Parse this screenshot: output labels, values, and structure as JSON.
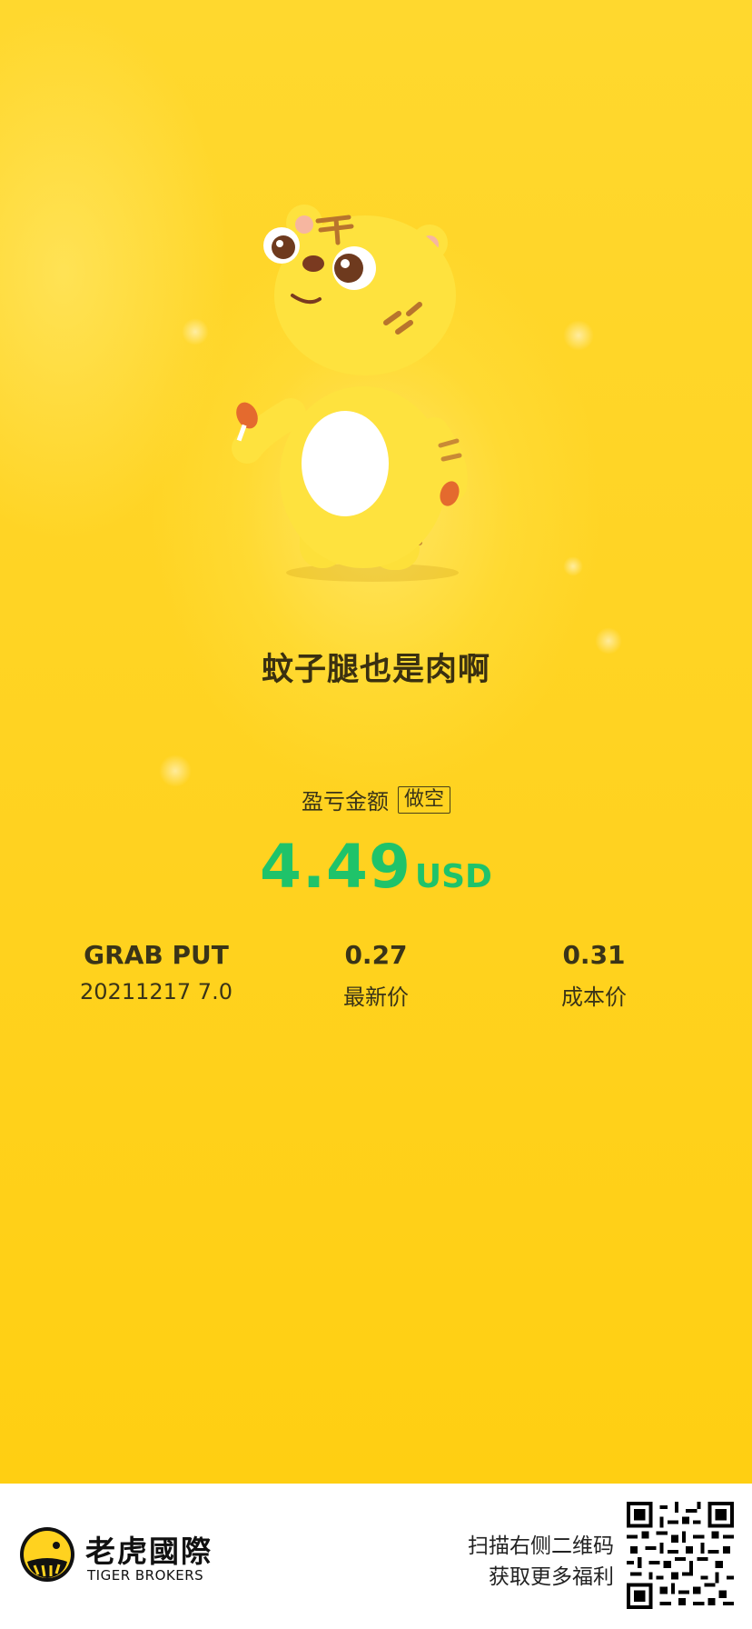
{
  "slogan": "蚊子腿也是肉啊",
  "pnl": {
    "label": "盈亏金额",
    "direction": "做空",
    "amount": "4.49",
    "currency": "USD",
    "amount_color": "#1fc36a"
  },
  "instrument": {
    "name": "GRAB PUT",
    "detail": "20211217  7.0"
  },
  "latest_price": {
    "value": "0.27",
    "label": "最新价"
  },
  "cost_price": {
    "value": "0.31",
    "label": "成本价"
  },
  "footer": {
    "brand_cn": "老虎國際",
    "brand_en": "TIGER BROKERS",
    "promo_line1": "扫描右侧二维码",
    "promo_line2": "获取更多福利",
    "logo_icon": "tiger-brokers-logo",
    "qr_icon": "qr-code"
  },
  "colors": {
    "background": "#ffd42a",
    "profit_green": "#1fc36a"
  }
}
